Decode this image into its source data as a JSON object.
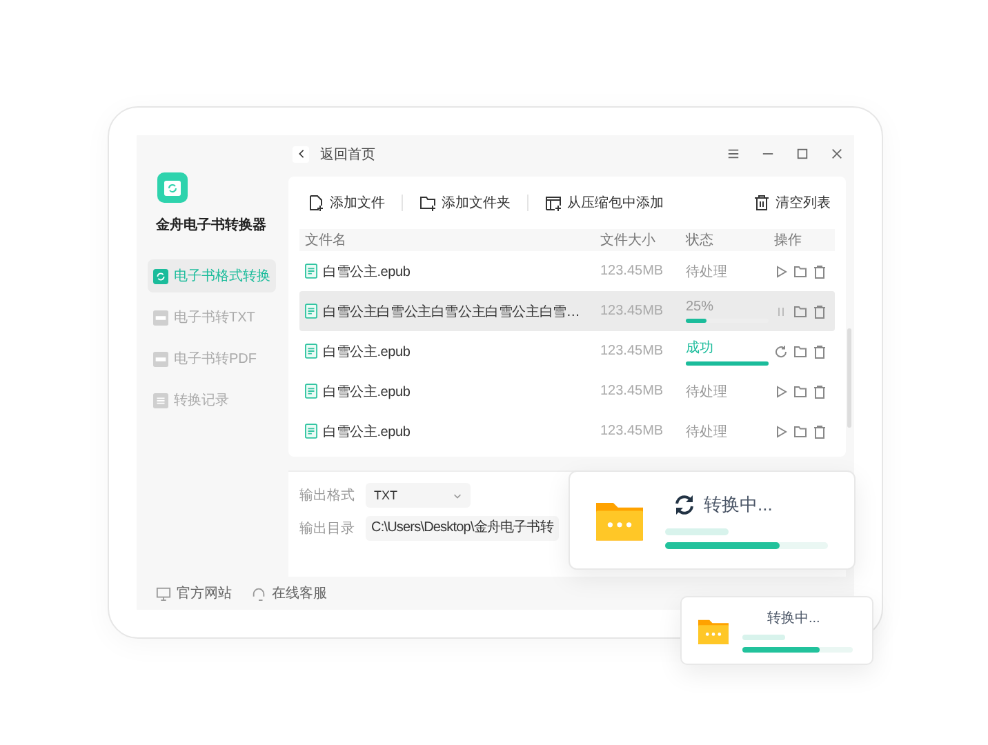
{
  "app": {
    "name": "金舟电子书转换器"
  },
  "sidebar": {
    "items": [
      {
        "label": "电子书格式转换",
        "selected": true
      },
      {
        "label": "电子书转TXT",
        "selected": false
      },
      {
        "label": "电子书转PDF",
        "selected": false
      },
      {
        "label": "转换记录",
        "selected": false
      }
    ]
  },
  "titlebar": {
    "back": "返回首页"
  },
  "toolbar": {
    "buttons": [
      {
        "label": "添加文件"
      },
      {
        "label": "添加文件夹"
      },
      {
        "label": "从压缩包中添加"
      }
    ],
    "clear": "清空列表"
  },
  "table": {
    "columns": [
      "文件名",
      "文件大小",
      "状态",
      "操作"
    ],
    "rows": [
      {
        "name": "白雪公主.epub",
        "size": "123.45MB",
        "kind": "pending",
        "status": "待处理",
        "selected": false
      },
      {
        "name": "白雪公主白雪公主白雪公主白雪公主白雪…",
        "size": "123.45MB",
        "kind": "progress",
        "status": "25%",
        "level": 0.25,
        "selected": true
      },
      {
        "name": "白雪公主.epub",
        "size": "123.45MB",
        "kind": "success",
        "status": "成功",
        "level": 1,
        "selected": false
      },
      {
        "name": "白雪公主.epub",
        "size": "123.45MB",
        "kind": "pending",
        "status": "待处理",
        "selected": false
      },
      {
        "name": "白雪公主.epub",
        "size": "123.45MB",
        "kind": "pending",
        "status": "待处理",
        "selected": false
      }
    ]
  },
  "output": {
    "format_label": "输出格式",
    "format": "TXT",
    "dir_label": "输出目录",
    "dir": "C:\\Users\\Desktop\\金舟电子书转"
  },
  "footer": {
    "links": [
      {
        "label": "官方网站"
      },
      {
        "label": "在线客服"
      }
    ]
  },
  "popups": [
    {
      "title": "转换中...",
      "level": 0.7
    },
    {
      "title": "转换中...",
      "level": 0.7
    }
  ]
}
